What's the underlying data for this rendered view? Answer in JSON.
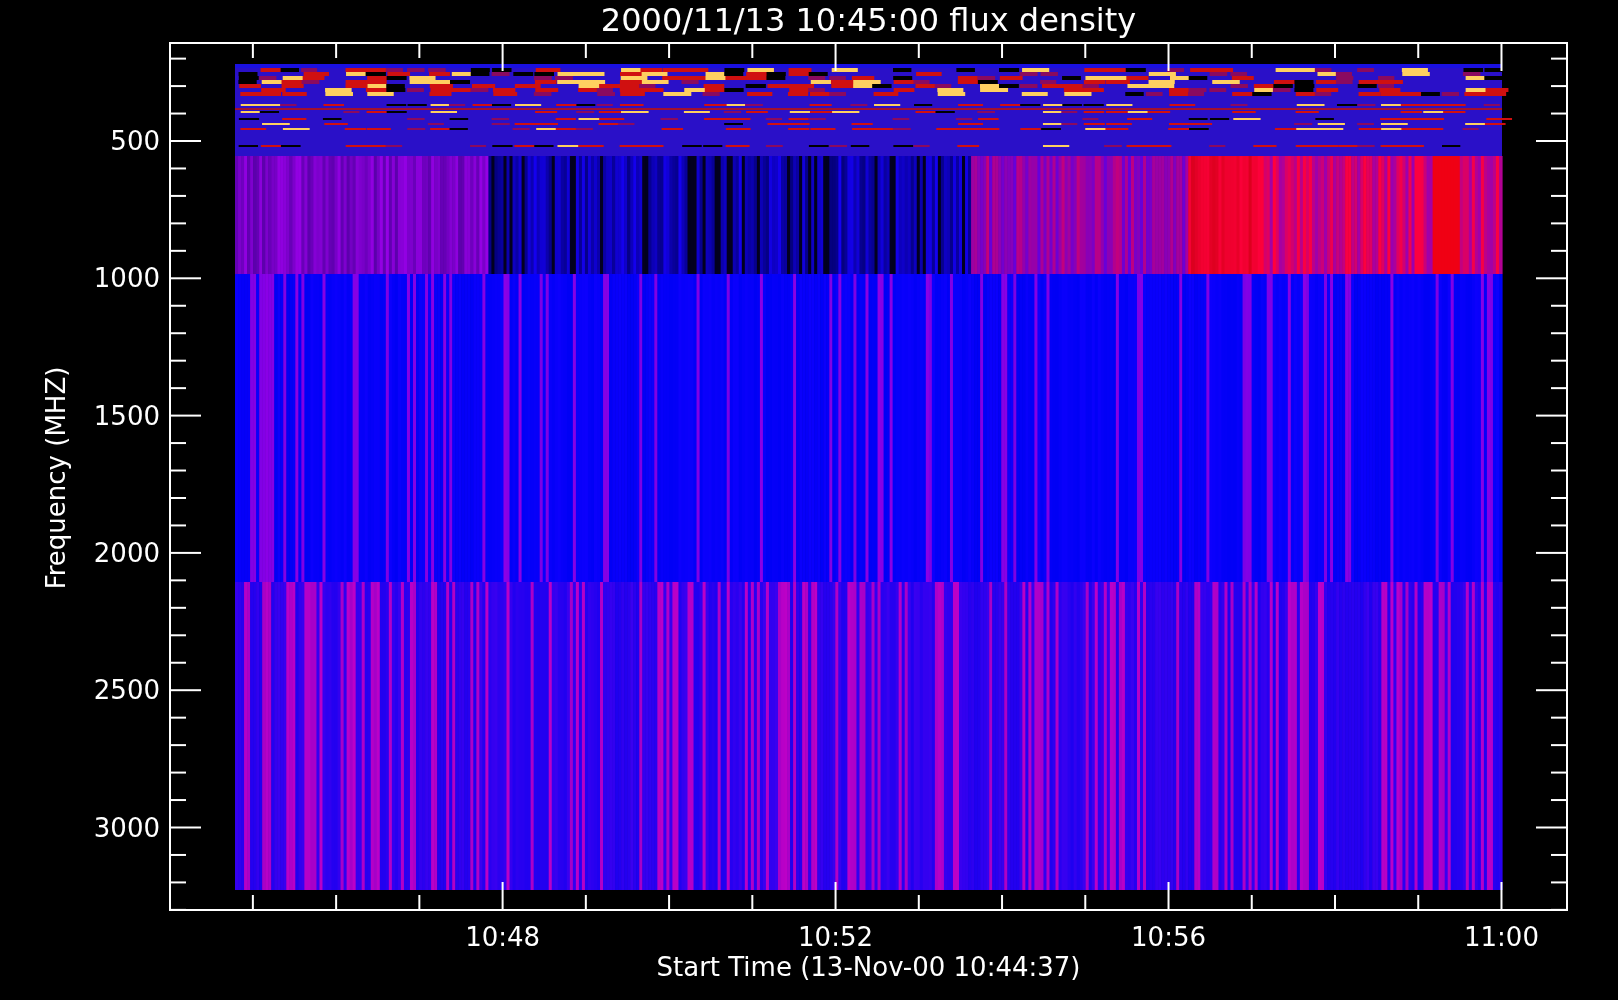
{
  "plot": {
    "title": "2000/11/13 10:45:00 flux density",
    "xlabel": "Start Time (13-Nov-00 10:44:37)",
    "ylabel": "Frequency (MHZ)",
    "xticks": [
      "10:48",
      "10:52",
      "10:56",
      "11:00"
    ],
    "yticks": [
      "500",
      "1000",
      "1500",
      "2000",
      "2500",
      "3000"
    ]
  }
}
